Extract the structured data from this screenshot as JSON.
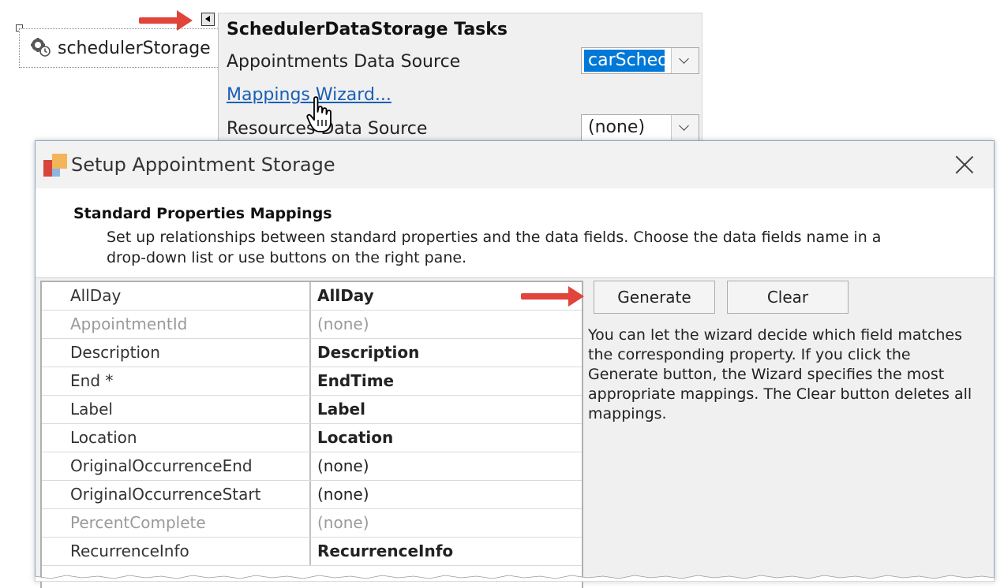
{
  "component": {
    "label": "schedulerStorage",
    "icon": "scheduler-storage-icon"
  },
  "tasks": {
    "title": "SchedulerDataStorage Tasks",
    "appointments_label": "Appointments Data Source",
    "appointments_value": "carSched",
    "mappings_link": "Mappings Wizard...",
    "resources_label": "Resources Data Source",
    "resources_value": "(none)"
  },
  "dialog": {
    "title": "Setup Appointment Storage",
    "section_title": "Standard Properties Mappings",
    "section_desc": "Set up relationships between standard properties and the data fields. Choose the data fields name in a drop-down list or use buttons on the right pane.",
    "generate_label": "Generate",
    "clear_label": "Clear",
    "help_text": "You can let the wizard decide which field matches the corresponding property. If you click the Generate button, the Wizard specifies the most appropriate mappings. The Clear button deletes all mappings.",
    "rows": [
      {
        "property": "AllDay",
        "field": "AllDay"
      },
      {
        "property": "AppointmentId",
        "field": "(none)"
      },
      {
        "property": "Description",
        "field": "Description"
      },
      {
        "property": "End *",
        "field": "EndTime"
      },
      {
        "property": "Label",
        "field": "Label"
      },
      {
        "property": "Location",
        "field": "Location"
      },
      {
        "property": "OriginalOccurrenceEnd",
        "field": "(none)"
      },
      {
        "property": "OriginalOccurrenceStart",
        "field": "(none)"
      },
      {
        "property": "PercentComplete",
        "field": "(none)"
      },
      {
        "property": "RecurrenceInfo",
        "field": "RecurrenceInfo"
      }
    ]
  },
  "colors": {
    "accent": "#0078d7",
    "link": "#1a5fb4",
    "arrow": "#e0443a"
  }
}
